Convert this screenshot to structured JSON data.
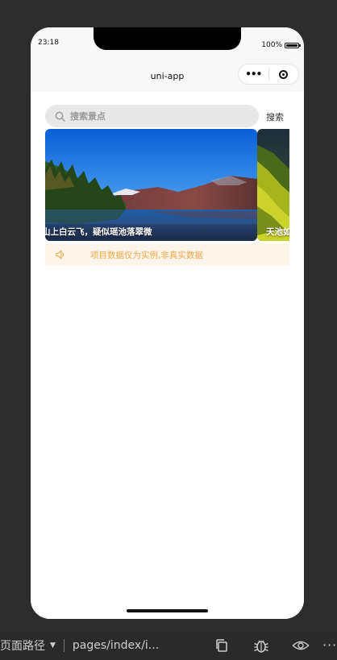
{
  "status_bar": {
    "time": "23:18",
    "battery": "100%"
  },
  "nav_bar": {
    "title": "uni-app",
    "more_icon": "more-dots-icon",
    "close_icon": "target-close-icon"
  },
  "search": {
    "placeholder": "搜索景点",
    "value": "",
    "button_label": "搜索"
  },
  "swiper": {
    "slides": [
      {
        "caption": "山上白云飞，疑似瑶池落翠微"
      },
      {
        "caption": "天池如"
      }
    ]
  },
  "notice": {
    "icon": "speaker-icon",
    "text": "项目数据仅为实例,非真实数据",
    "color": "#f0a84c",
    "background": "#fdf4ea"
  },
  "devtools": {
    "path_label": "页面路径",
    "path_value": "pages/index/i...",
    "icons": [
      "copy-icon",
      "bug-icon",
      "eye-icon",
      "more-icon"
    ],
    "more_glyph": "···"
  }
}
